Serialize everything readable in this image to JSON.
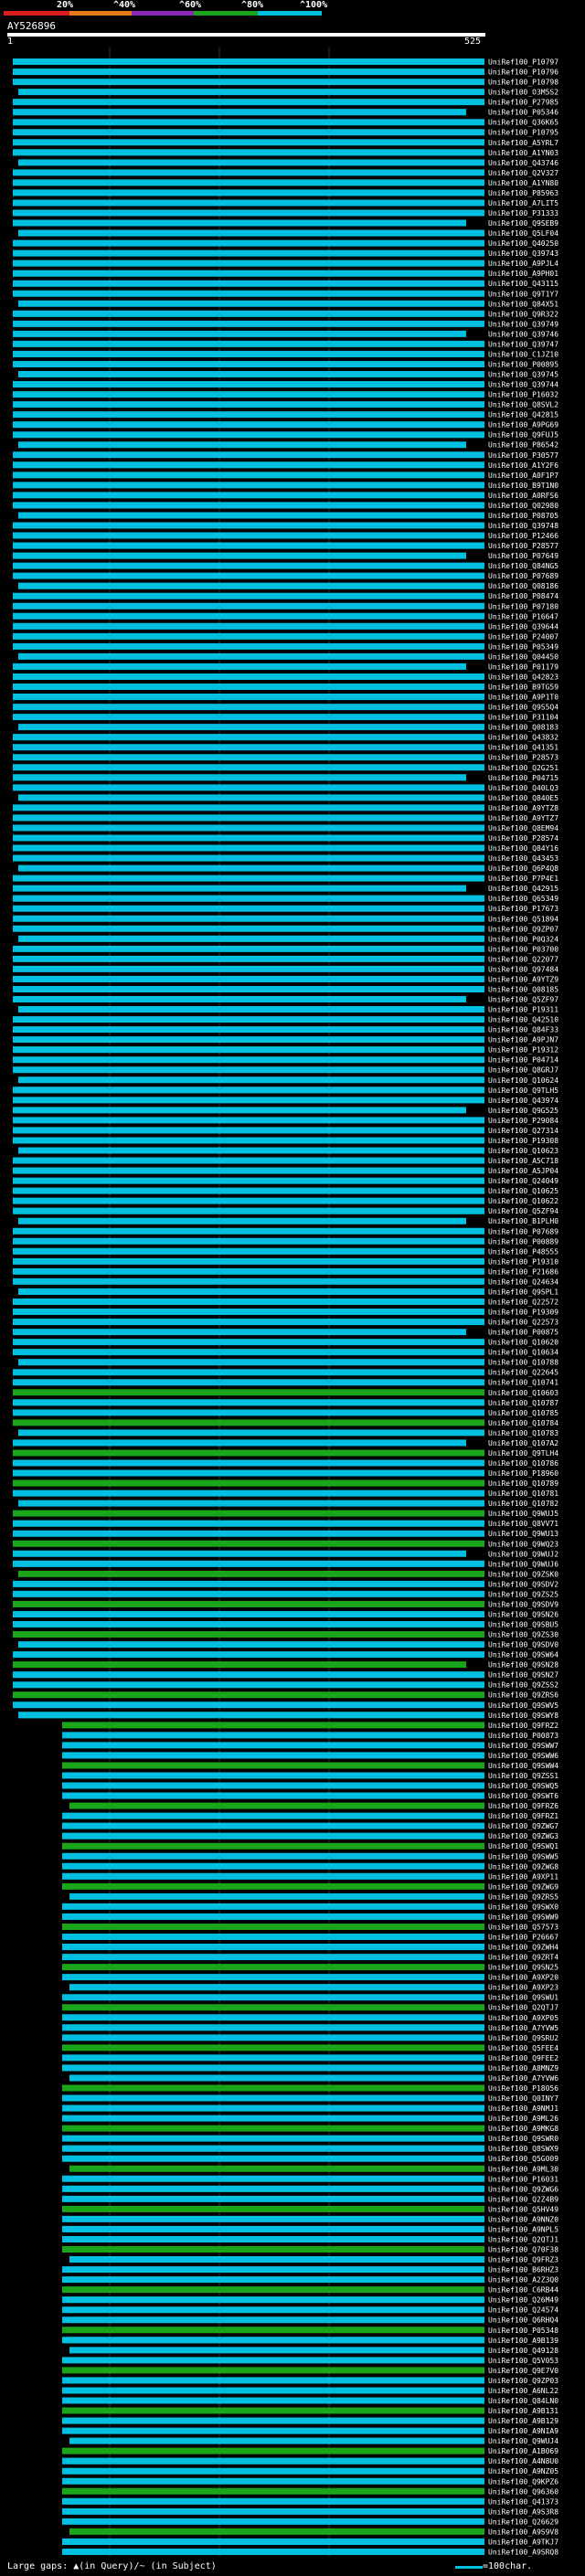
{
  "legend": {
    "labels": [
      "20%",
      "^40%",
      "^60%",
      "^80%",
      "^100%"
    ],
    "colors": [
      "#d81e1e",
      "#e87a1a",
      "#8a2ab8",
      "#1aa51a",
      "#00bfe0"
    ]
  },
  "query": {
    "title": "AY526896",
    "start_tick": "1",
    "end_tick": "525"
  },
  "hit_ids": [
    "UniRef100_P10797",
    "UniRef100_P10796",
    "UniRef100_P10798",
    "UniRef100_O3M5S2",
    "UniRef100_P27985",
    "UniRef100_P05346",
    "UniRef100_Q36K65",
    "UniRef100_P10795",
    "UniRef100_A5YRL7",
    "UniRef100_A1YN03",
    "UniRef100_Q43746",
    "UniRef100_Q2V327",
    "UniRef100_A1YN80",
    "UniRef100_P85963",
    "UniRef100_A7LIT5",
    "UniRef100_P31333",
    "UniRef100_Q9SEB9",
    "UniRef100_Q5LF04",
    "UniRef100_Q40250",
    "UniRef100_Q39743",
    "UniRef100_A9PJL4",
    "UniRef100_A9PH01",
    "UniRef100_Q43115",
    "UniRef100_Q9T1Y7",
    "UniRef100_Q84X51",
    "UniRef100_Q9R322",
    "UniRef100_Q39749",
    "UniRef100_Q39746",
    "UniRef100_Q39747",
    "UniRef100_C1JZ10",
    "UniRef100_P00895",
    "UniRef100_Q39745",
    "UniRef100_Q39744",
    "UniRef100_P16032",
    "UniRef100_Q8SVL2",
    "UniRef100_Q42815",
    "UniRef100_A9PG69",
    "UniRef100_Q9FUJ5",
    "UniRef100_P86542",
    "UniRef100_P30577",
    "UniRef100_A1Y2F6",
    "UniRef100_A0F1P7",
    "UniRef100_B9T1N0",
    "UniRef100_A0RFS6",
    "UniRef100_Q02980",
    "UniRef100_P08705",
    "UniRef100_Q39748",
    "UniRef100_P12466",
    "UniRef100_P28577",
    "UniRef100_P07649",
    "UniRef100_Q84NG5",
    "UniRef100_P07689",
    "UniRef100_Q08186",
    "UniRef100_P08474",
    "UniRef100_P07180",
    "UniRef100_P16647",
    "UniRef100_Q39644",
    "UniRef100_P24007",
    "UniRef100_P05349",
    "UniRef100_Q04450",
    "UniRef100_P01179",
    "UniRef100_Q42823",
    "UniRef100_B9TG59",
    "UniRef100_A9P1T0",
    "UniRef100_Q9S5Q4",
    "UniRef100_P31104",
    "UniRef100_Q08183",
    "UniRef100_Q43832",
    "UniRef100_Q41351",
    "UniRef100_P28573",
    "UniRef100_Q2G251",
    "UniRef100_P04715",
    "UniRef100_Q40LQ3",
    "UniRef100_Q840E5",
    "UniRef100_A9YTZ8",
    "UniRef100_A9YTZ7",
    "UniRef100_Q8EM94",
    "UniRef100_P28574",
    "UniRef100_Q84Y16",
    "UniRef100_Q43453",
    "UniRef100_Q6P4Q8",
    "UniRef100_P7P4E1",
    "UniRef100_Q42915",
    "UniRef100_Q65349",
    "UniRef100_P17673",
    "UniRef100_Q51894",
    "UniRef100_Q9ZP07",
    "UniRef100_P0Q324",
    "UniRef100_P03700",
    "UniRef100_Q22077",
    "UniRef100_Q97484",
    "UniRef100_A9YTZ9",
    "UniRef100_Q08185",
    "UniRef100_Q5ZF97",
    "UniRef100_P19311",
    "UniRef100_Q42510",
    "UniRef100_Q84F33",
    "UniRef100_A9PJN7",
    "UniRef100_P19312",
    "UniRef100_P04714",
    "UniRef100_Q8GRJ7",
    "UniRef100_Q10624",
    "UniRef100_Q9TLH5",
    "UniRef100_Q43974",
    "UniRef100_Q9G525",
    "UniRef100_P29084",
    "UniRef100_Q27314",
    "UniRef100_P19308",
    "UniRef100_Q10623",
    "UniRef100_A5C718",
    "UniRef100_A5JP04",
    "UniRef100_Q24049",
    "UniRef100_Q10625",
    "UniRef100_Q10622",
    "UniRef100_Q5ZF94",
    "UniRef100_B1PLH0",
    "UniRef100_P07689",
    "UniRef100_P00889",
    "UniRef100_P48555",
    "UniRef100_P19310",
    "UniRef100_P21686",
    "UniRef100_Q24634",
    "UniRef100_Q9SPL1",
    "UniRef100_Q22572",
    "UniRef100_P19309",
    "UniRef100_Q22573",
    "UniRef100_P00875",
    "UniRef100_Q10620",
    "UniRef100_Q10634",
    "UniRef100_Q10788",
    "UniRef100_Q22645",
    "UniRef100_Q10741",
    "UniRef100_Q10603",
    "UniRef100_Q10787",
    "UniRef100_Q10785",
    "UniRef100_Q10784",
    "UniRef100_Q10783",
    "UniRef100_Q107A2",
    "UniRef100_Q9TLH4",
    "UniRef100_Q10786",
    "UniRef100_P18960",
    "UniRef100_Q10789",
    "UniRef100_Q10781",
    "UniRef100_Q10782",
    "UniRef100_Q9WUJ5",
    "UniRef100_Q8VV71",
    "UniRef100_Q9WU13",
    "UniRef100_Q9WQ23",
    "UniRef100_Q9WUJ2",
    "UniRef100_Q9WUJ6",
    "UniRef100_Q9ZSK0",
    "UniRef100_Q9SDV2",
    "UniRef100_Q9ZS25",
    "UniRef100_Q9SDV9",
    "UniRef100_Q9SN26",
    "UniRef100_Q9SBU5",
    "UniRef100_Q9ZS30",
    "UniRef100_Q9SDV0",
    "UniRef100_Q9SW64",
    "UniRef100_Q9SN28",
    "UniRef100_Q9SN27",
    "UniRef100_Q9ZSS2",
    "UniRef100_Q9ZRS6",
    "UniRef100_Q9SWV5",
    "UniRef100_Q9SWY8",
    "UniRef100_Q9FRZ2",
    "UniRef100_P00873",
    "UniRef100_Q9SWW7",
    "UniRef100_Q9SWW6",
    "UniRef100_Q9SWW4",
    "UniRef100_Q9ZSS1",
    "UniRef100_Q9SWQ5",
    "UniRef100_Q9SWT6",
    "UniRef100_Q9FRZ6",
    "UniRef100_Q9FRZ1",
    "UniRef100_Q9ZWG7",
    "UniRef100_Q9ZWG3",
    "UniRef100_Q9SWQ1",
    "UniRef100_Q9SWW5",
    "UniRef100_Q9ZWG8",
    "UniRef100_A9XP11",
    "UniRef100_Q9ZWG9",
    "UniRef100_Q9ZRS5",
    "UniRef100_Q9SWX0",
    "UniRef100_Q9SWW9",
    "UniRef100_Q57573",
    "UniRef100_P26667",
    "UniRef100_Q9ZWH4",
    "UniRef100_Q9ZRT4",
    "UniRef100_Q9SN25",
    "UniRef100_A9XP20",
    "UniRef100_A9XP23",
    "UniRef100_Q9SWU1",
    "UniRef100_Q2QTJ7",
    "UniRef100_A9XP05",
    "UniRef100_A7YVW5",
    "UniRef100_Q9SRU2",
    "UniRef100_Q5FEE4",
    "UniRef100_Q9FEE2",
    "UniRef100_A8MNZ9",
    "UniRef100_A7YVW6",
    "UniRef100_P18056",
    "UniRef100_Q0INY7",
    "UniRef100_A9NMJ1",
    "UniRef100_A9ML26",
    "UniRef100_A9MKG8",
    "UniRef100_Q9SWR0",
    "UniRef100_Q8SWX9",
    "UniRef100_Q5G009",
    "UniRef100_A9ML30",
    "UniRef100_P16031",
    "UniRef100_Q9ZWG6",
    "UniRef100_Q2Z4B9",
    "UniRef100_Q5HV49",
    "UniRef100_A9NNZ0",
    "UniRef100_A9NPL5",
    "UniRef100_Q2QTJ1",
    "UniRef100_Q70F38",
    "UniRef100_Q9FRZ3",
    "UniRef100_B6RHZ3",
    "UniRef100_A2Z3Q0",
    "UniRef100_C6RB44",
    "UniRef100_Q26M49",
    "UniRef100_Q24574",
    "UniRef100_Q6RHQ4",
    "UniRef100_P05348",
    "UniRef100_A9B139",
    "UniRef100_Q49128",
    "UniRef100_Q5V053",
    "UniRef100_Q9E7V0",
    "UniRef100_Q9ZP03",
    "UniRef100_A6NL22",
    "UniRef100_Q84LN0",
    "UniRef100_A9B131",
    "UniRef100_A9B129",
    "UniRef100_A9NIA9",
    "UniRef100_Q9WUJ4",
    "UniRef100_A1B069",
    "UniRef100_A4N8U0",
    "UniRef100_A9NZ05",
    "UniRef100_Q9KPZ6",
    "UniRef100_Q96360",
    "UniRef100_Q41373",
    "UniRef100_A9S3R8",
    "UniRef100_Q26629",
    "UniRef100_A9S9V8",
    "UniRef100_A9TKJ7",
    "UniRef100_A9SRQ8"
  ],
  "footer": {
    "gap_label": "Large gaps: ▲(in Query)/~ (in Subject)",
    "scale_label": "=100char."
  }
}
